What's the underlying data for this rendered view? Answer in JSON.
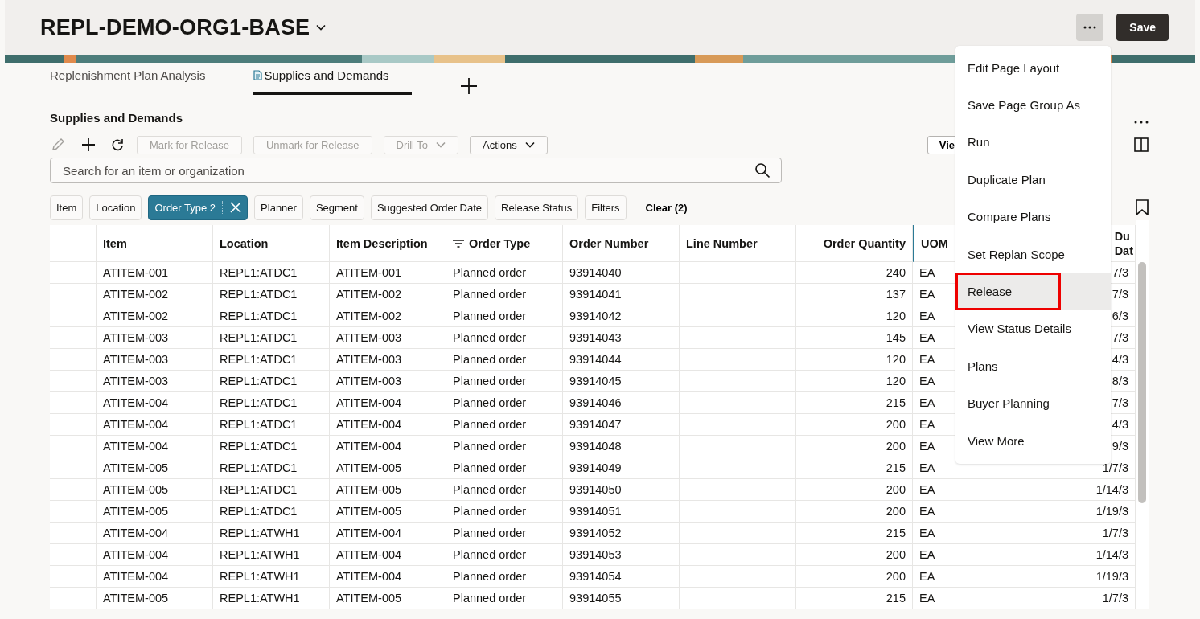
{
  "header": {
    "title": "REPL-DEMO-ORG1-BASE",
    "save_label": "Save"
  },
  "tabs": [
    {
      "label": "Replenishment Plan Analysis",
      "selected": false,
      "kind": "plain"
    },
    {
      "label": "Supplies and Demands",
      "selected": true,
      "kind": "document"
    }
  ],
  "section_title": "Supplies and Demands",
  "toolbar": {
    "buttons": [
      {
        "label": "Mark for Release",
        "disabled": true,
        "kind": "plain"
      },
      {
        "label": "Unmark for Release",
        "disabled": true,
        "kind": "plain"
      },
      {
        "label": "Drill To",
        "disabled": true,
        "kind": "dropdown"
      },
      {
        "label": "Actions",
        "disabled": false,
        "kind": "dropdown"
      }
    ],
    "view_button": "Vie"
  },
  "search": {
    "placeholder": "Search for an item or organization"
  },
  "filters": [
    {
      "label": "Item",
      "selected": false
    },
    {
      "label": "Location",
      "selected": false
    },
    {
      "label": "Order Type 2",
      "selected": true
    },
    {
      "label": "Planner",
      "selected": false
    },
    {
      "label": "Segment",
      "selected": false
    },
    {
      "label": "Suggested Order Date",
      "selected": false
    },
    {
      "label": "Release Status",
      "selected": false
    },
    {
      "label": "Filters",
      "selected": false
    }
  ],
  "clear_filters": "Clear (2)",
  "table": {
    "columns": [
      {
        "label": "Item",
        "kind": "text"
      },
      {
        "label": "Location",
        "kind": "text"
      },
      {
        "label": "Item Description",
        "kind": "text"
      },
      {
        "label": "Order Type",
        "kind": "filtered"
      },
      {
        "label": "Order Number",
        "kind": "text"
      },
      {
        "label": "Line Number",
        "kind": "text"
      },
      {
        "label": "Order Quantity",
        "kind": "number"
      },
      {
        "label": "UOM",
        "kind": "marked"
      },
      {
        "label": "Du\nDat",
        "kind": "date"
      }
    ],
    "rows": [
      [
        "ATITEM-001",
        "REPL1:ATDC1",
        "ATITEM-001",
        "Planned order",
        "93914040",
        "",
        "240",
        "EA",
        "7/3"
      ],
      [
        "ATITEM-002",
        "REPL1:ATDC1",
        "ATITEM-002",
        "Planned order",
        "93914041",
        "",
        "137",
        "EA",
        "7/3"
      ],
      [
        "ATITEM-002",
        "REPL1:ATDC1",
        "ATITEM-002",
        "Planned order",
        "93914042",
        "",
        "120",
        "EA",
        "6/3"
      ],
      [
        "ATITEM-003",
        "REPL1:ATDC1",
        "ATITEM-003",
        "Planned order",
        "93914043",
        "",
        "145",
        "EA",
        "7/3"
      ],
      [
        "ATITEM-003",
        "REPL1:ATDC1",
        "ATITEM-003",
        "Planned order",
        "93914044",
        "",
        "120",
        "EA",
        "4/3"
      ],
      [
        "ATITEM-003",
        "REPL1:ATDC1",
        "ATITEM-003",
        "Planned order",
        "93914045",
        "",
        "120",
        "EA",
        "8/3"
      ],
      [
        "ATITEM-004",
        "REPL1:ATDC1",
        "ATITEM-004",
        "Planned order",
        "93914046",
        "",
        "215",
        "EA",
        "7/3"
      ],
      [
        "ATITEM-004",
        "REPL1:ATDC1",
        "ATITEM-004",
        "Planned order",
        "93914047",
        "",
        "200",
        "EA",
        "4/3"
      ],
      [
        "ATITEM-004",
        "REPL1:ATDC1",
        "ATITEM-004",
        "Planned order",
        "93914048",
        "",
        "200",
        "EA",
        "9/3"
      ],
      [
        "ATITEM-005",
        "REPL1:ATDC1",
        "ATITEM-005",
        "Planned order",
        "93914049",
        "",
        "215",
        "EA",
        "1/7/3"
      ],
      [
        "ATITEM-005",
        "REPL1:ATDC1",
        "ATITEM-005",
        "Planned order",
        "93914050",
        "",
        "200",
        "EA",
        "1/14/3"
      ],
      [
        "ATITEM-005",
        "REPL1:ATDC1",
        "ATITEM-005",
        "Planned order",
        "93914051",
        "",
        "200",
        "EA",
        "1/19/3"
      ],
      [
        "ATITEM-004",
        "REPL1:ATWH1",
        "ATITEM-004",
        "Planned order",
        "93914052",
        "",
        "215",
        "EA",
        "1/7/3"
      ],
      [
        "ATITEM-004",
        "REPL1:ATWH1",
        "ATITEM-004",
        "Planned order",
        "93914053",
        "",
        "200",
        "EA",
        "1/14/3"
      ],
      [
        "ATITEM-004",
        "REPL1:ATWH1",
        "ATITEM-004",
        "Planned order",
        "93914054",
        "",
        "200",
        "EA",
        "1/19/3"
      ],
      [
        "ATITEM-005",
        "REPL1:ATWH1",
        "ATITEM-005",
        "Planned order",
        "93914055",
        "",
        "215",
        "EA",
        "1/7/3"
      ]
    ]
  },
  "menu": {
    "items": [
      {
        "label": "Edit Page Layout",
        "selected": false
      },
      {
        "label": "Save Page Group As",
        "selected": false
      },
      {
        "label": "Run",
        "selected": false
      },
      {
        "label": "Duplicate Plan",
        "selected": false
      },
      {
        "label": "Compare Plans",
        "selected": false
      },
      {
        "label": "Set Replan Scope",
        "selected": false
      },
      {
        "label": "Release",
        "selected": true
      },
      {
        "label": "View Status Details",
        "selected": false
      },
      {
        "label": "Plans",
        "selected": false
      },
      {
        "label": "Buyer Planning",
        "selected": false
      },
      {
        "label": "View More",
        "selected": false
      }
    ]
  }
}
